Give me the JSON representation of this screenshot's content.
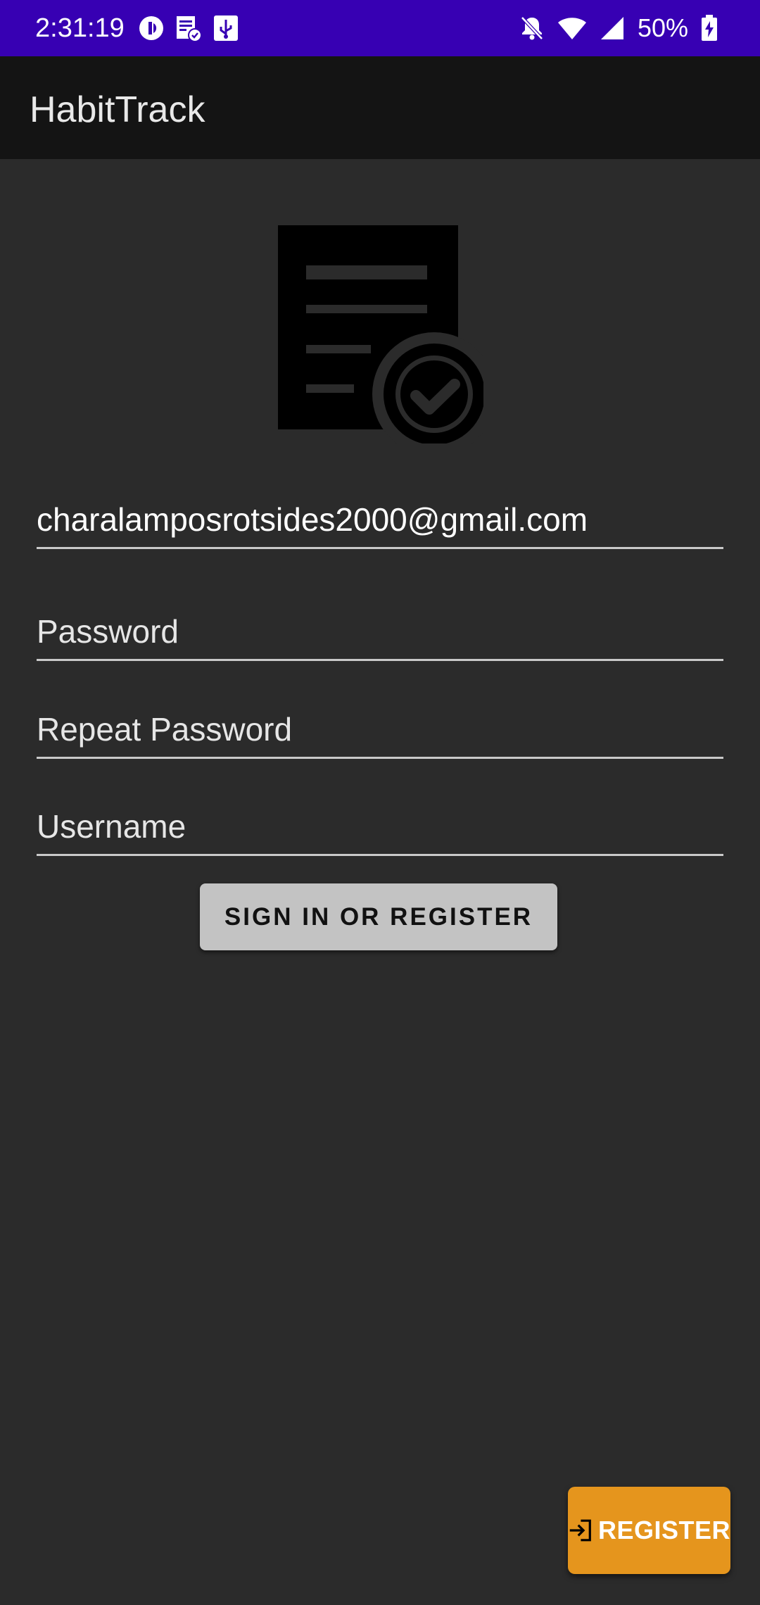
{
  "status_bar": {
    "time": "2:31:19",
    "battery": "50%",
    "left_icons": [
      "app-circle-icon",
      "document-check-icon",
      "usb-icon"
    ],
    "right_icons": [
      "bell-off-icon",
      "wifi-icon",
      "signal-icon",
      "battery-charging-icon"
    ]
  },
  "app_bar": {
    "title": "HabitTrack"
  },
  "logo": {
    "icon": "document-check-icon"
  },
  "form": {
    "email_value": "charalamposrotsides2000@gmail.com",
    "password_placeholder": "Password",
    "repeat_password_placeholder": "Repeat Password",
    "username_placeholder": "Username",
    "submit_label": "SIGN IN OR REGISTER"
  },
  "fab": {
    "label": "REGISTER",
    "icon": "login-arrow-icon"
  },
  "colors": {
    "status_bar": "#3700b3",
    "app_bar": "#141414",
    "background": "#2b2b2b",
    "accent": "#e5951d"
  }
}
